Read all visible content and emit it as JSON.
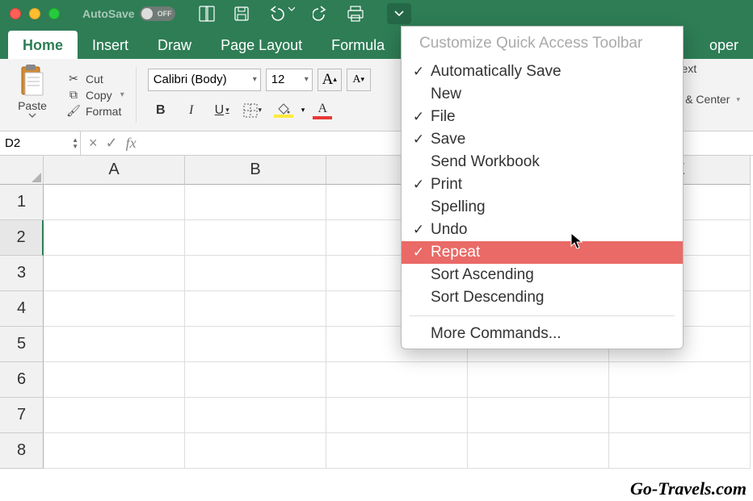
{
  "titlebar": {
    "autosave_label": "AutoSave",
    "autosave_state": "OFF"
  },
  "tabs": {
    "t0": "Home",
    "t1": "Insert",
    "t2": "Draw",
    "t3": "Page Layout",
    "t4": "Formula",
    "t5": "oper",
    "active_index": 0
  },
  "ribbon": {
    "paste": "Paste",
    "cut": "Cut",
    "copy": "Copy",
    "format": "Format",
    "font_name": "Calibri (Body)",
    "font_size": "12",
    "bigA": "A",
    "smallA": "A",
    "bold": "B",
    "italic": "I",
    "underline": "U",
    "font_color_letter": "A",
    "wrap_text": "Text",
    "merge_center": "e & Center"
  },
  "fxbar": {
    "namebox": "D2",
    "cancel": "×",
    "confirm": "✓",
    "fx": "fx",
    "formula": ""
  },
  "columns": [
    "A",
    "B",
    "",
    "",
    "E"
  ],
  "rows": [
    "1",
    "2",
    "3",
    "4",
    "5",
    "6",
    "7",
    "8"
  ],
  "active_cell": {
    "row": 2,
    "col_name": "D"
  },
  "qat_menu": {
    "title": "Customize Quick Access Toolbar",
    "items": [
      {
        "label": "Automatically Save",
        "checked": true
      },
      {
        "label": "New",
        "checked": false
      },
      {
        "label": "File",
        "checked": true
      },
      {
        "label": "Save",
        "checked": true
      },
      {
        "label": "Send Workbook",
        "checked": false
      },
      {
        "label": "Print",
        "checked": true
      },
      {
        "label": "Spelling",
        "checked": false
      },
      {
        "label": "Undo",
        "checked": true
      },
      {
        "label": "Repeat",
        "checked": true,
        "highlight": true
      },
      {
        "label": "Sort Ascending",
        "checked": false
      },
      {
        "label": "Sort Descending",
        "checked": false
      }
    ],
    "more": "More Commands..."
  },
  "watermark": "Go-Travels.com"
}
